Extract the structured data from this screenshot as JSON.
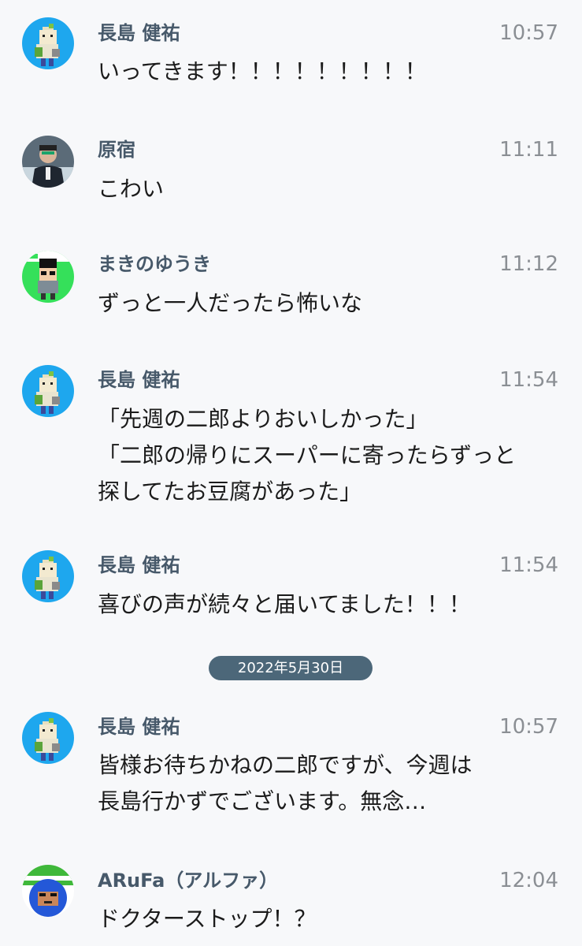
{
  "messages": [
    {
      "name": "長島 健祐",
      "time": "10:57",
      "lines": [
        "いってきます！！！！！！！！！"
      ],
      "avatar": "nagashima-avatar"
    },
    {
      "name": "原宿",
      "time": "11:11",
      "lines": [
        "こわい"
      ],
      "avatar": "harajuku-avatar"
    },
    {
      "name": "まきのゆうき",
      "time": "11:12",
      "lines": [
        "ずっと一人だったら怖いな"
      ],
      "avatar": "makino-avatar"
    },
    {
      "name": "長島 健祐",
      "time": "11:54",
      "lines": [
        "「先週の二郎よりおいしかった」",
        "「二郎の帰りにスーパーに寄ったらずっと",
        "探してたお豆腐があった」"
      ],
      "avatar": "nagashima-avatar"
    },
    {
      "name": "長島 健祐",
      "time": "11:54",
      "lines": [
        "喜びの声が続々と届いてました！！！"
      ],
      "avatar": "nagashima-avatar"
    },
    {
      "name": "長島 健祐",
      "time": "10:57",
      "lines": [
        "皆様お待ちかねの二郎ですが、今週は",
        "長島行かずでございます。無念…"
      ],
      "avatar": "nagashima-avatar"
    },
    {
      "name": "ARuFa（アルファ）",
      "time": "12:04",
      "lines": [
        "ドクターストップ！？"
      ],
      "avatar": "arufa-avatar"
    }
  ],
  "date_separator": "2022年5月30日",
  "colors": {
    "background": "#f7f8fa",
    "name": "#47596a",
    "time": "#8b8f94",
    "text": "#1b1b1b",
    "date_pill": "#4c6779",
    "avatar_blue": "#1ea7ee"
  }
}
